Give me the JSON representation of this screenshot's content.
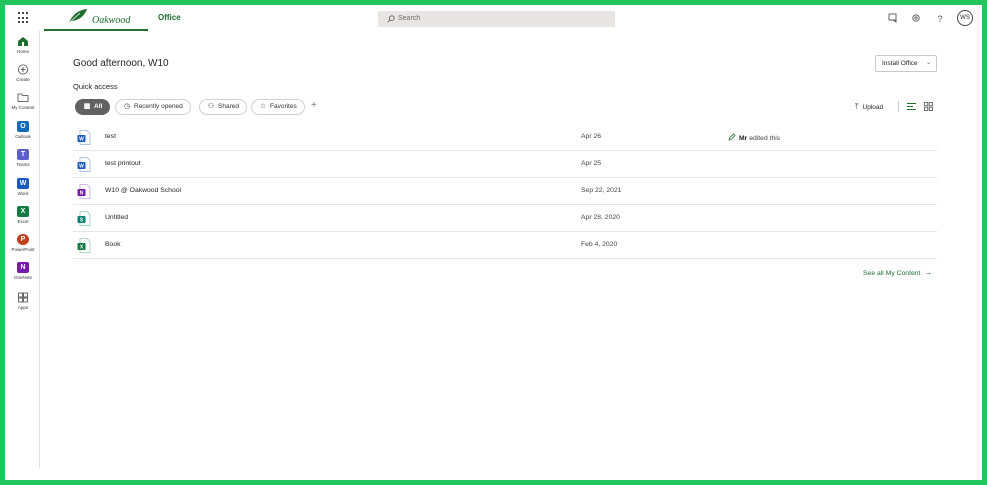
{
  "header": {
    "logo_text": "Oakwood",
    "app_title": "Office",
    "search_placeholder": "Search",
    "avatar_initials": "WS"
  },
  "rail": [
    {
      "label": "Home",
      "icon": "home-icon"
    },
    {
      "label": "Create",
      "icon": "create-icon"
    },
    {
      "label": "My Content",
      "icon": "folder-icon"
    },
    {
      "label": "Outlook",
      "icon": "outlook-icon",
      "letter": "O",
      "color": "#0f6cbd"
    },
    {
      "label": "Teams",
      "icon": "teams-icon",
      "letter": "T",
      "color": "#5b5fc7"
    },
    {
      "label": "Word",
      "icon": "word-icon",
      "letter": "W",
      "color": "#185abd"
    },
    {
      "label": "Excel",
      "icon": "excel-icon",
      "letter": "X",
      "color": "#107c41"
    },
    {
      "label": "PowerPoint",
      "icon": "powerpoint-icon",
      "letter": "P",
      "color": "#c43e1c"
    },
    {
      "label": "OneNote",
      "icon": "onenote-icon",
      "letter": "N",
      "color": "#7719aa"
    },
    {
      "label": "Apps",
      "icon": "apps-icon"
    }
  ],
  "main": {
    "greeting": "Good afternoon, W10",
    "install_label": "Install Office",
    "quick_access": "Quick access",
    "filters": [
      {
        "label": "All",
        "icon": "all-icon"
      },
      {
        "label": "Recently opened",
        "icon": "clock-icon"
      },
      {
        "label": "Shared",
        "icon": "people-icon"
      },
      {
        "label": "Favorites",
        "icon": "star-icon"
      }
    ],
    "upload_label": "Upload",
    "files": [
      {
        "name": "test",
        "date": "Apr 26",
        "type": "word",
        "activity_user": "Mr",
        "activity_text": "edited this"
      },
      {
        "name": "test printout",
        "date": "Apr 25",
        "type": "word",
        "activity_user": "",
        "activity_text": ""
      },
      {
        "name": "W10 @ Oakwood School",
        "date": "Sep 22, 2021",
        "type": "onenote",
        "activity_user": "",
        "activity_text": ""
      },
      {
        "name": "Untitled",
        "date": "Apr 28, 2020",
        "type": "sway",
        "activity_user": "",
        "activity_text": ""
      },
      {
        "name": "Book",
        "date": "Feb 4, 2020",
        "type": "excel",
        "activity_user": "",
        "activity_text": ""
      }
    ],
    "see_all_label": "See all My Content"
  },
  "colors": {
    "accent": "#1f6f2e",
    "frame": "#22c55e",
    "word": "#185abd",
    "excel": "#107c41",
    "onenote": "#7719aa",
    "sway": "#008272"
  }
}
